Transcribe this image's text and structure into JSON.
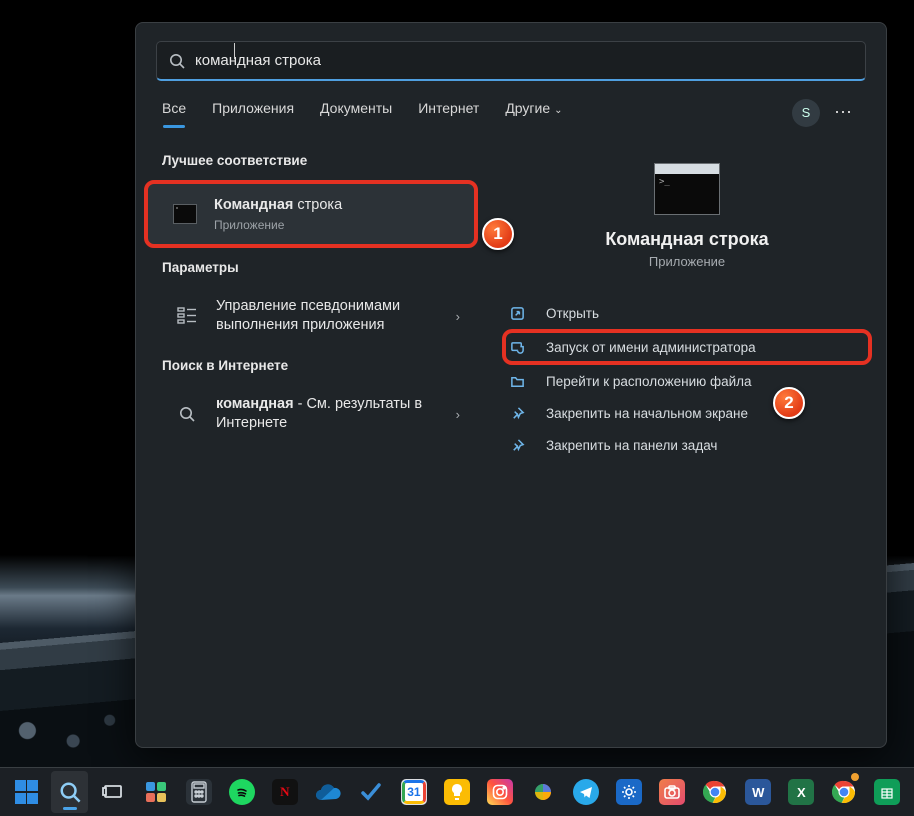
{
  "search": {
    "query": "командная строка"
  },
  "tabs": {
    "all": "Все",
    "apps": "Приложения",
    "docs": "Документы",
    "web": "Интернет",
    "more": "Другие"
  },
  "user_initial": "S",
  "sections": {
    "best": "Лучшее соответствие",
    "settings": "Параметры",
    "web": "Поиск в Интернете"
  },
  "results": {
    "cmd": {
      "title_bold": "Командная",
      "title_rest": " строка",
      "sub": "Приложение"
    },
    "alias": {
      "title": "Управление псевдонимами выполнения приложения"
    },
    "web": {
      "title_bold": "командная",
      "title_rest": " - См. результаты в Интернете"
    }
  },
  "preview": {
    "title": "Командная строка",
    "sub": "Приложение"
  },
  "actions": {
    "open": "Открыть",
    "admin": "Запуск от имени администратора",
    "location": "Перейти к расположению файла",
    "pin_start": "Закрепить на начальном экране",
    "pin_taskbar": "Закрепить на панели задач"
  },
  "callouts": {
    "one": "1",
    "two": "2"
  },
  "taskbar": [
    {
      "name": "start",
      "bg": "",
      "glyph": "win"
    },
    {
      "name": "search",
      "bg": "#2a3138",
      "glyph": "search"
    },
    {
      "name": "taskview",
      "bg": "",
      "glyph": "taskview"
    },
    {
      "name": "widgets",
      "bg": "",
      "glyph": "widgets"
    },
    {
      "name": "calculator",
      "bg": "#232a31",
      "glyph": "calc"
    },
    {
      "name": "spotify",
      "bg": "#1ed760",
      "glyph": "♪"
    },
    {
      "name": "netflix",
      "bg": "#111",
      "glyph": "N",
      "fg": "#e50914"
    },
    {
      "name": "onedrive",
      "bg": "",
      "glyph": "cloud"
    },
    {
      "name": "todo",
      "bg": "",
      "glyph": "check"
    },
    {
      "name": "gcal",
      "bg": "#fff",
      "glyph": "31",
      "fg": "#1a73e8"
    },
    {
      "name": "keep",
      "bg": "#fbbc04",
      "glyph": "keep"
    },
    {
      "name": "instagram",
      "bg": "linear-gradient(45deg,#fd5,#ff543e,#c837ab)",
      "glyph": "ig"
    },
    {
      "name": "photos",
      "bg": "",
      "glyph": "photos"
    },
    {
      "name": "telegram",
      "bg": "#29a9ea",
      "glyph": "tg"
    },
    {
      "name": "settings",
      "bg": "#1a69c7",
      "glyph": "gear"
    },
    {
      "name": "camera",
      "bg": "#e8553a",
      "glyph": "cam"
    },
    {
      "name": "chrome",
      "bg": "",
      "glyph": "chrome"
    },
    {
      "name": "word",
      "bg": "#2b579a",
      "glyph": "W",
      "fg": "#fff"
    },
    {
      "name": "excel",
      "bg": "#217346",
      "glyph": "X",
      "fg": "#fff"
    },
    {
      "name": "chrome2",
      "bg": "",
      "glyph": "chrome"
    },
    {
      "name": "sheets",
      "bg": "#0f9d58",
      "glyph": "sheets"
    }
  ]
}
